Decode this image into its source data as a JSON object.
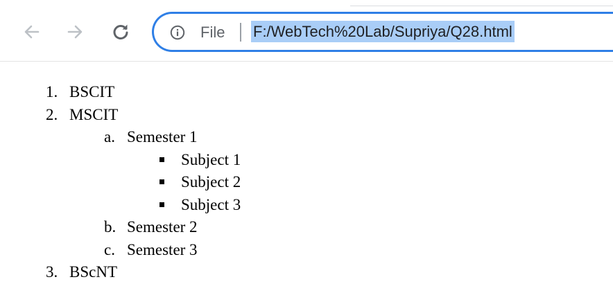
{
  "browser": {
    "url_scheme_label": "File",
    "url": "F:/WebTech%20Lab/Supriya/Q28.html",
    "colors": {
      "omnibox_border": "#2f7fe6",
      "url_selection": "#a9cdf7",
      "icon_gray": "#5f6368"
    },
    "icons": {
      "back": "arrow-left-icon",
      "forward": "arrow-right-icon",
      "reload": "reload-icon",
      "info": "info-icon"
    }
  },
  "page": {
    "list": [
      {
        "marker": "1.",
        "label": "BSCIT"
      },
      {
        "marker": "2.",
        "label": "MSCIT",
        "children": [
          {
            "marker": "a.",
            "label": "Semester 1",
            "children": [
              {
                "label": "Subject 1"
              },
              {
                "label": "Subject 2"
              },
              {
                "label": "Subject 3"
              }
            ]
          },
          {
            "marker": "b.",
            "label": "Semester 2"
          },
          {
            "marker": "c.",
            "label": "Semester 3"
          }
        ]
      },
      {
        "marker": "3.",
        "label": "BScNT"
      }
    ]
  }
}
